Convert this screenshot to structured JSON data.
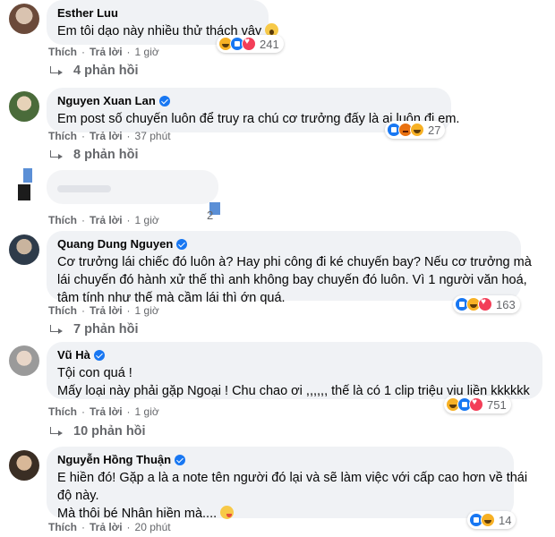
{
  "comments": [
    {
      "name": "Esther Luu",
      "verified": false,
      "lines": [
        "Em tôi dạo này nhiều thử thách vậy"
      ],
      "like_label": "Thích",
      "reply_label": "Trả lời",
      "time": "1 giờ",
      "reactions": [
        "haha",
        "like",
        "love"
      ],
      "reaction_count": "241",
      "replies": "4 phản hồi"
    },
    {
      "name": "Nguyen Xuan Lan",
      "verified": true,
      "lines": [
        "Em post số chuyến luôn để truy ra chú cơ trưởng đấy là ai luôn đi em."
      ],
      "like_label": "Thích",
      "reply_label": "Trả lời",
      "time": "37 phút",
      "reactions": [
        "like",
        "angry",
        "haha"
      ],
      "reaction_count": "27",
      "replies": "8 phản hồi"
    },
    {
      "name": "",
      "verified": false,
      "lines": [
        ""
      ],
      "like_label": "Thích",
      "reply_label": "Trả lời",
      "time": "1 giờ",
      "reactions": [
        "like"
      ],
      "reaction_count": "2",
      "replies": ""
    },
    {
      "name": "Quang Dung Nguyen",
      "verified": true,
      "lines": [
        "Cơ trưởng lái chiếc đó luôn à? Hay phi công đi ké chuyến bay? Nếu cơ trưởng mà",
        "lái chuyến đó hành xử thế thì anh không bay chuyến đó luôn. Vì 1 người văn hoá,",
        "tâm tính như thế mà cầm lái thì ớn quá."
      ],
      "like_label": "Thích",
      "reply_label": "Trả lời",
      "time": "1 giờ",
      "reactions": [
        "like",
        "haha",
        "love"
      ],
      "reaction_count": "163",
      "replies": "7 phản hồi"
    },
    {
      "name": "Vũ Hà",
      "verified": true,
      "lines": [
        "Tội con quá !",
        "Mấy loại này phải gặp Ngoại ! Chu chao ơi ,,,,,, thế là có 1 clip triệu viu liền kkkkkk"
      ],
      "like_label": "Thích",
      "reply_label": "Trả lời",
      "time": "1 giờ",
      "reactions": [
        "haha",
        "like",
        "love"
      ],
      "reaction_count": "751",
      "replies": "10 phản hồi"
    },
    {
      "name": "Nguyễn Hồng Thuận",
      "verified": true,
      "lines": [
        "E hiền đó! Gặp a là a note tên người đó lại và sẽ làm việc với cấp cao hơn về thái",
        "độ này.",
        "Mà thôi bé Nhân hiền mà...."
      ],
      "like_label": "Thích",
      "reply_label": "Trả lời",
      "time": "20 phút",
      "reactions": [
        "like",
        "haha"
      ],
      "reaction_count": "14",
      "replies": ""
    }
  ],
  "colors": {
    "bubble": "#f0f2f5",
    "meta_text": "#65676b",
    "verified": "#1877f2"
  }
}
